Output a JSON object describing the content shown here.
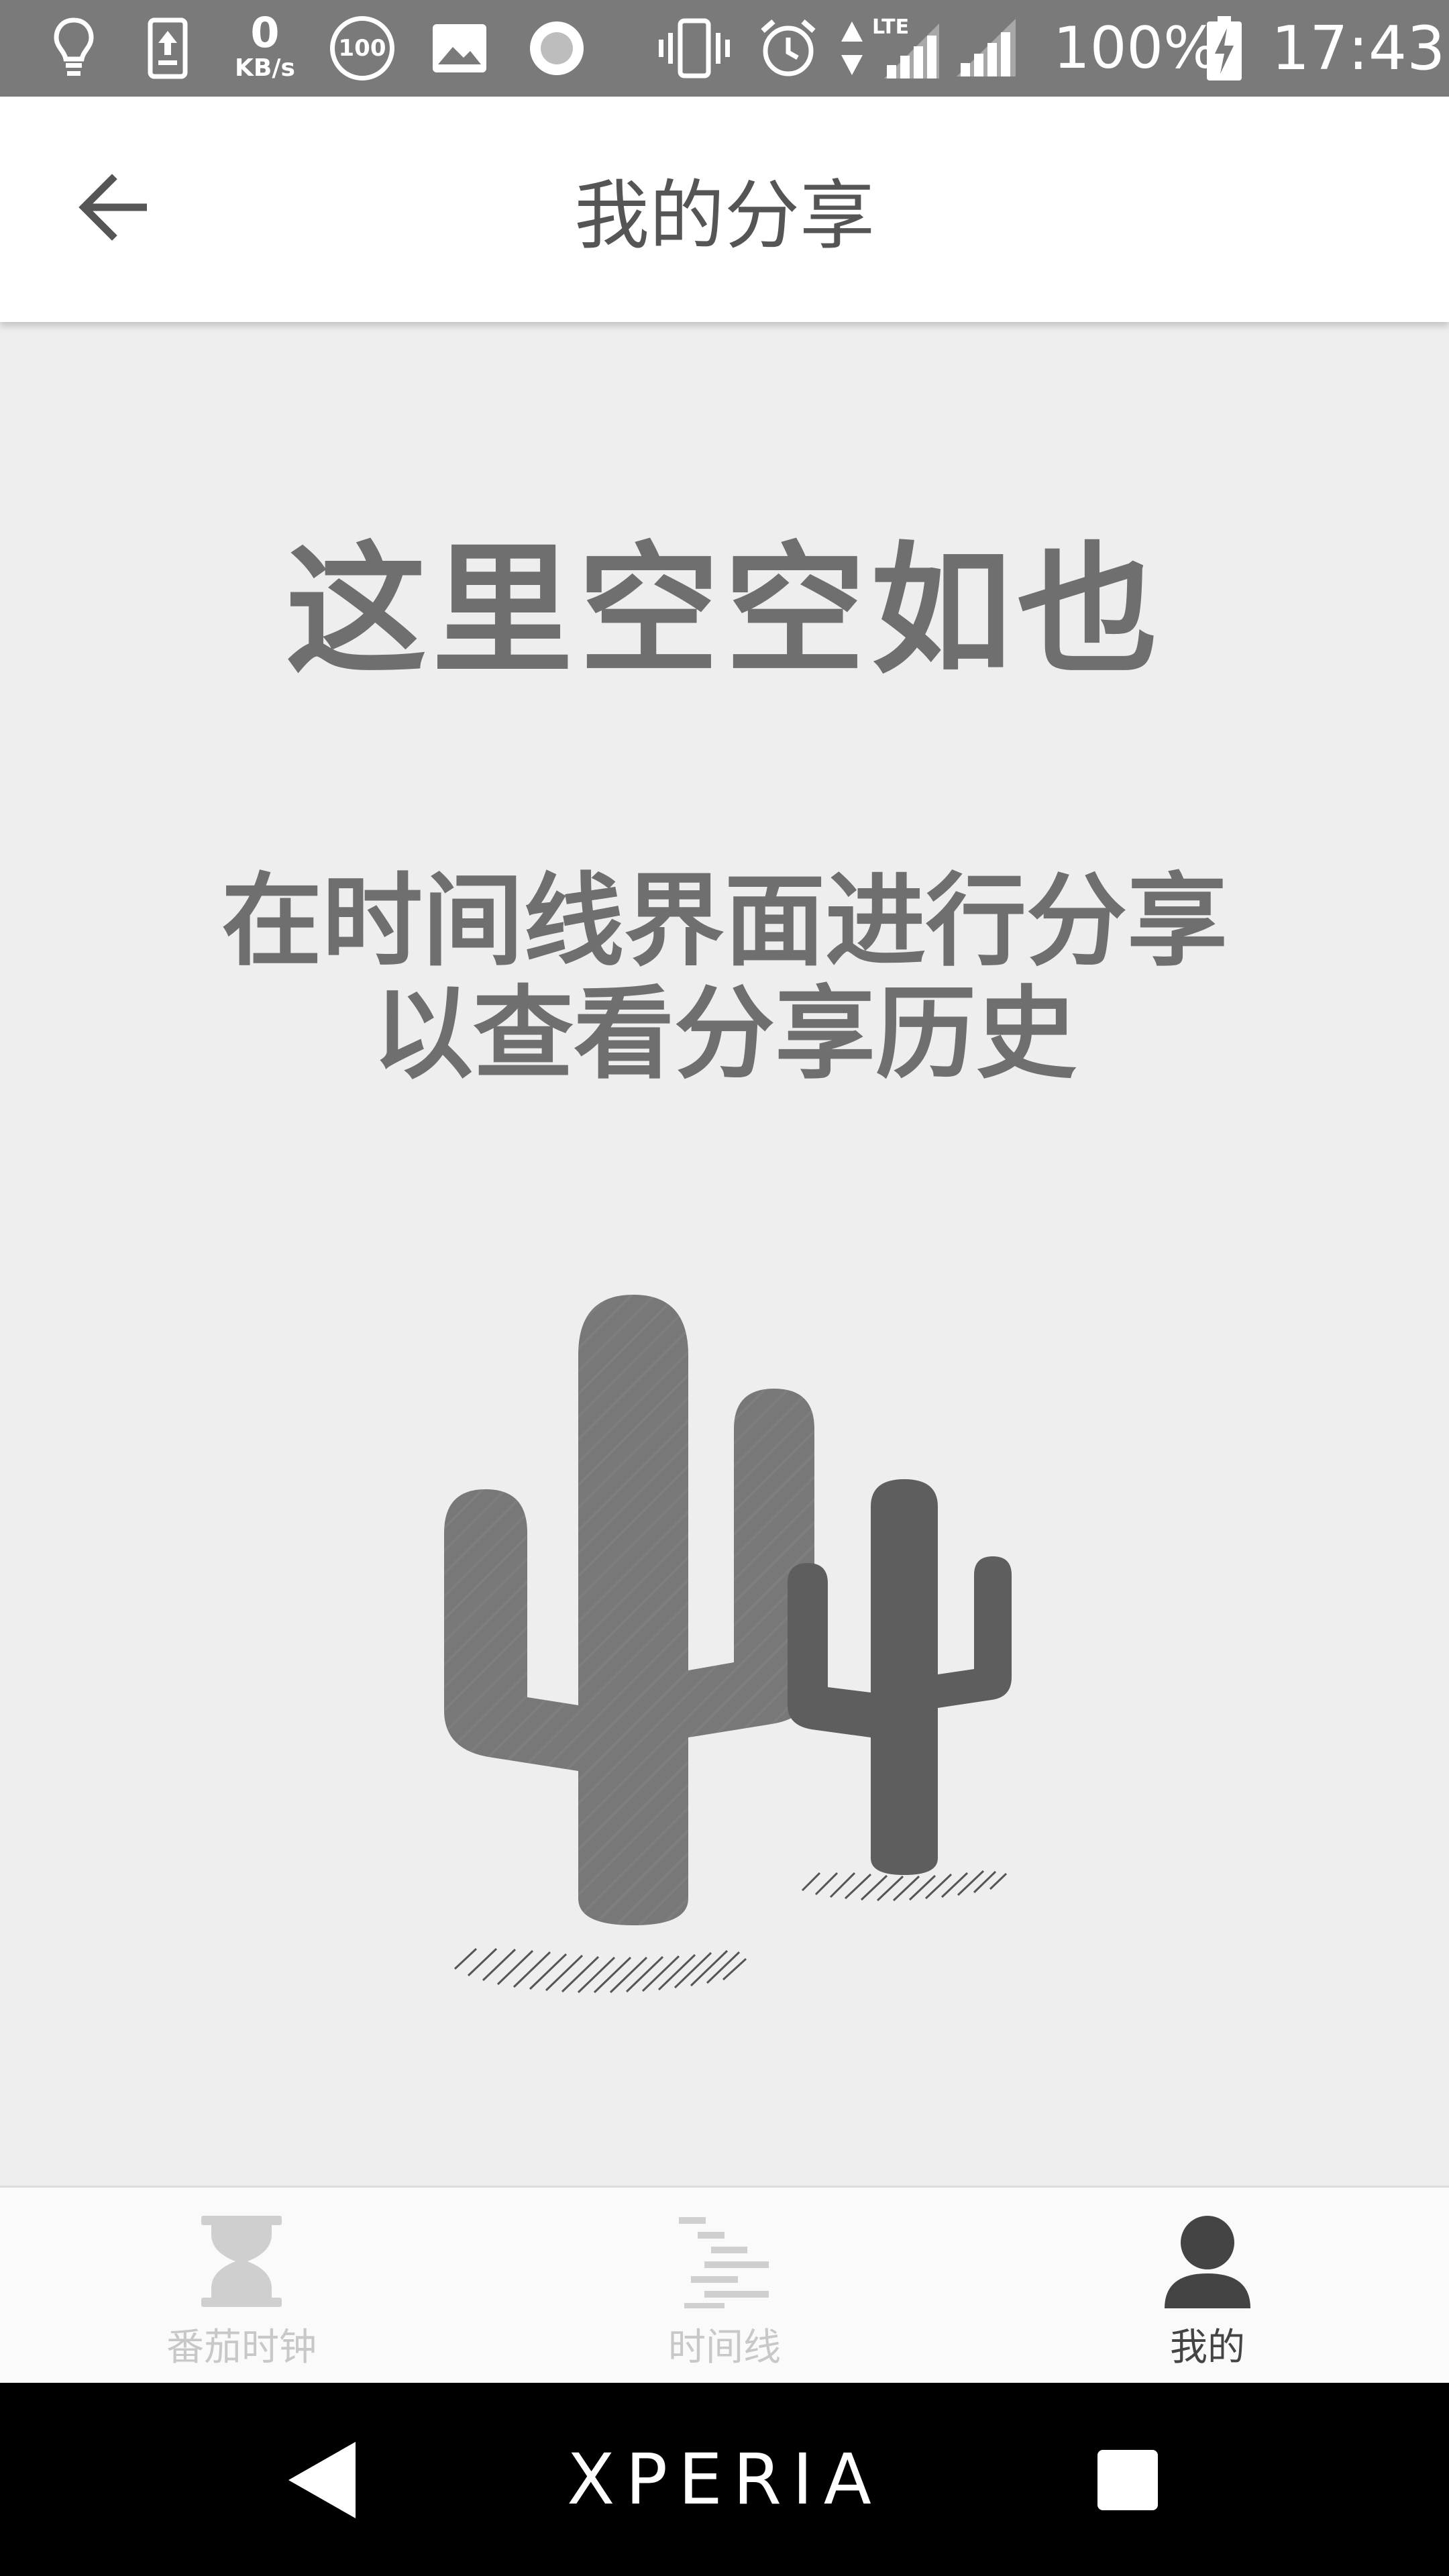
{
  "status_bar": {
    "net_speed_value": "0",
    "net_speed_unit": "KB/s",
    "badge_100": "100",
    "network_type": "LTE",
    "battery": "100%",
    "time": "17:43",
    "icons": [
      "lightbulb-icon",
      "upload-icon",
      "circle-100-icon",
      "image-icon",
      "record-icon",
      "vibrate-icon",
      "alarm-icon",
      "data-arrows-icon",
      "signal-lte-icon",
      "signal-icon",
      "battery-charging-icon"
    ]
  },
  "app_bar": {
    "back_icon": "arrow-left-icon",
    "title": "我的分享"
  },
  "empty_state": {
    "title": "这里空空如也",
    "hint_line1": "在时间线界面进行分享",
    "hint_line2": "以查看分享历史",
    "illustration": "cactus-illustration"
  },
  "bottom_nav": {
    "items": [
      {
        "label": "番茄时钟",
        "icon": "hourglass-icon",
        "active": false
      },
      {
        "label": "时间线",
        "icon": "timeline-icon",
        "active": false
      },
      {
        "label": "我的",
        "icon": "person-icon",
        "active": true
      }
    ],
    "active_color": "#444444",
    "inactive_color": "#c8c8c8"
  },
  "system_nav": {
    "brand": "XPERIA",
    "back_icon": "triangle-back-icon",
    "recents_icon": "square-recents-icon"
  }
}
